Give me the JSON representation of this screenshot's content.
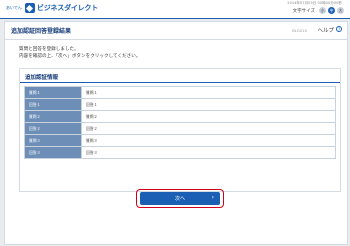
{
  "header": {
    "logo_prefix": "あいでん",
    "logo_text": "ビジネスダイレクト",
    "login_info_line1": "2014年07月05日 00時00分00秒",
    "login_info_line2": "前回ログイン",
    "font_size_label": "文字サイズ",
    "font_small": "小",
    "font_medium": "中",
    "font_large": "大"
  },
  "page": {
    "title": "追加認証回答登録結果",
    "screen_id": "BLG010",
    "help_label": "ヘルプ",
    "help_icon": "?"
  },
  "message": {
    "line1": "質問と回答を登録しました。",
    "line2": "内容を確認の上、「次へ」ボタンをクリックしてください。"
  },
  "section": {
    "title": "追加認証情報",
    "rows": [
      {
        "label": "質問１",
        "value": "質問１"
      },
      {
        "label": "回答１",
        "value": "回答１"
      },
      {
        "label": "質問２",
        "value": "質問２"
      },
      {
        "label": "回答２",
        "value": "回答２"
      },
      {
        "label": "質問３",
        "value": "質問３"
      },
      {
        "label": "回答３",
        "value": "回答３"
      }
    ]
  },
  "actions": {
    "next_label": "次へ",
    "next_icon": "chevron-right-icon"
  },
  "colors": {
    "brand": "#1a5fb4",
    "title": "#1a3f7a",
    "table_label_bg": "#6d8fb7",
    "highlight": "#d0021b"
  }
}
